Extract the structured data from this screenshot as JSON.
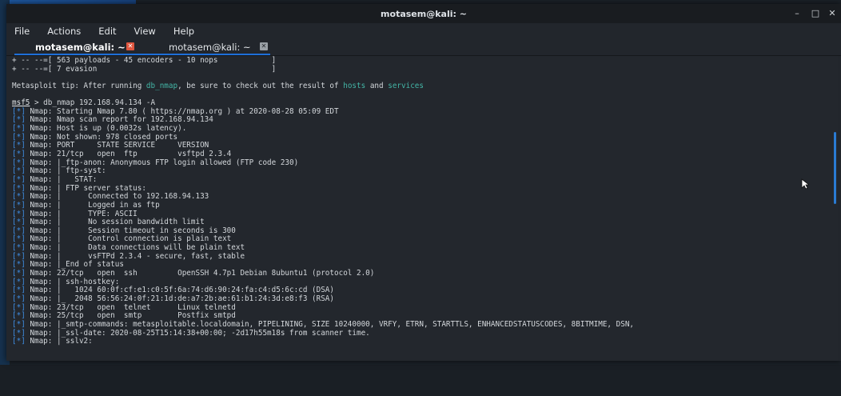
{
  "window": {
    "title": "motasem@kali: ~"
  },
  "menu": [
    "File",
    "Actions",
    "Edit",
    "View",
    "Help"
  ],
  "tabs": [
    {
      "label": "motasem@kali: ~",
      "active": true
    },
    {
      "label": "motasem@kali: ~",
      "active": false
    }
  ],
  "terminal": {
    "banner": [
      "+ -- --=[ 563 payloads - 45 encoders - 10 nops            ]",
      "+ -- --=[ 7 evasion                                       ]"
    ],
    "tip": {
      "prefix": "Metasploit tip: After running ",
      "cmd1": "db_nmap",
      "mid": ", be sure to check out the result of ",
      "cmd2": "hosts",
      "and": " and ",
      "cmd3": "services"
    },
    "prompt": "msf5",
    "command": " > db_nmap 192.168.94.134 -A",
    "tag": "[*]",
    "output": [
      " Nmap: Starting Nmap 7.80 ( https://nmap.org ) at 2020-08-28 05:09 EDT",
      " Nmap: Nmap scan report for 192.168.94.134",
      " Nmap: Host is up (0.0032s latency).",
      " Nmap: Not shown: 978 closed ports",
      " Nmap: PORT     STATE SERVICE     VERSION",
      " Nmap: 21/tcp   open  ftp         vsftpd 2.3.4",
      " Nmap: |_ftp-anon: Anonymous FTP login allowed (FTP code 230)",
      " Nmap: | ftp-syst:",
      " Nmap: |   STAT:",
      " Nmap: | FTP server status:",
      " Nmap: |      Connected to 192.168.94.133",
      " Nmap: |      Logged in as ftp",
      " Nmap: |      TYPE: ASCII",
      " Nmap: |      No session bandwidth limit",
      " Nmap: |      Session timeout in seconds is 300",
      " Nmap: |      Control connection is plain text",
      " Nmap: |      Data connections will be plain text",
      " Nmap: |      vsFTPd 2.3.4 - secure, fast, stable",
      " Nmap: |_End of status",
      " Nmap: 22/tcp   open  ssh         OpenSSH 4.7p1 Debian 8ubuntu1 (protocol 2.0)",
      " Nmap: | ssh-hostkey:",
      " Nmap: |   1024 60:0f:cf:e1:c0:5f:6a:74:d6:90:24:fa:c4:d5:6c:cd (DSA)",
      " Nmap: |_  2048 56:56:24:0f:21:1d:de:a7:2b:ae:61:b1:24:3d:e8:f3 (RSA)",
      " Nmap: 23/tcp   open  telnet      Linux telnetd",
      " Nmap: 25/tcp   open  smtp        Postfix smtpd",
      " Nmap: |_smtp-commands: metasploitable.localdomain, PIPELINING, SIZE 10240000, VRFY, ETRN, STARTTLS, ENHANCEDSTATUSCODES, 8BITMIME, DSN,",
      " Nmap: |_ssl-date: 2020-08-25T15:14:38+00:00; -2d17h55m18s from scanner time.",
      " Nmap: | sslv2:"
    ]
  }
}
